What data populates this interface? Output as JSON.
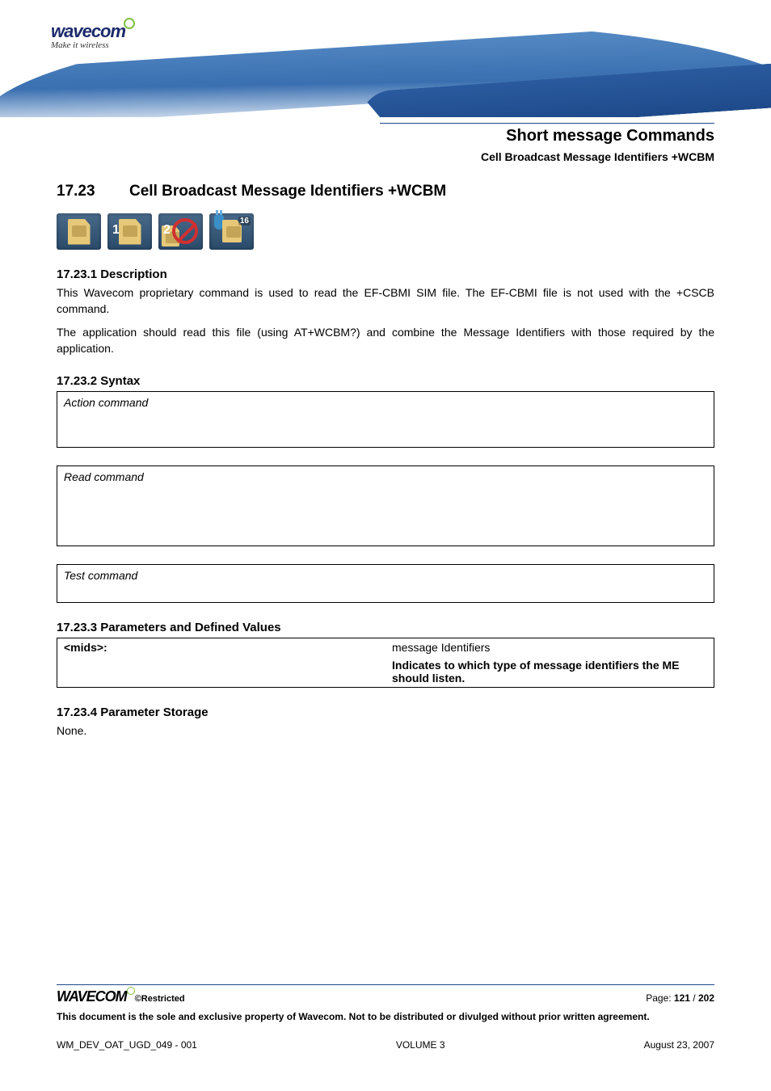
{
  "logo": {
    "word": "wavecom",
    "tagline": "Make it wireless"
  },
  "header": {
    "chapter": "Short message Commands",
    "subtitle": "Cell Broadcast Message Identifiers +WCBM"
  },
  "section": {
    "num": "17.23",
    "title": "Cell Broadcast Message Identifiers +WCBM"
  },
  "icons": {
    "sim1_badge": "1",
    "sim2_badge": "2",
    "sim3_badge": "16"
  },
  "s1": {
    "h": "17.23.1  Description",
    "p1": "This Wavecom proprietary command is used to read the EF-CBMI SIM file. The EF-CBMI file is not used with the +CSCB command.",
    "p2": "The application should read this file (using AT+WCBM?) and combine the Message Identifiers with those required by the application."
  },
  "s2": {
    "h": "17.23.2  Syntax",
    "action": "Action command",
    "read": "Read command",
    "test": "Test command"
  },
  "s3": {
    "h": "17.23.3  Parameters and Defined Values",
    "param_name": "<mids>:",
    "param_r1": "message Identifiers",
    "param_r2": "Indicates to which type of message identifiers the ME should listen."
  },
  "s4": {
    "h": "17.23.4  Parameter Storage",
    "body": "None."
  },
  "footer": {
    "logo": "WAVECOM",
    "restricted": "©Restricted",
    "page_label": "Page: ",
    "page_cur": "121",
    "page_sep": " / ",
    "page_total": "202",
    "disclaimer": "This document is the sole and exclusive property of Wavecom. Not to be distributed or divulged without prior written agreement.",
    "docid": "WM_DEV_OAT_UGD_049 - 001",
    "volume": "VOLUME 3",
    "date": "August 23, 2007"
  }
}
